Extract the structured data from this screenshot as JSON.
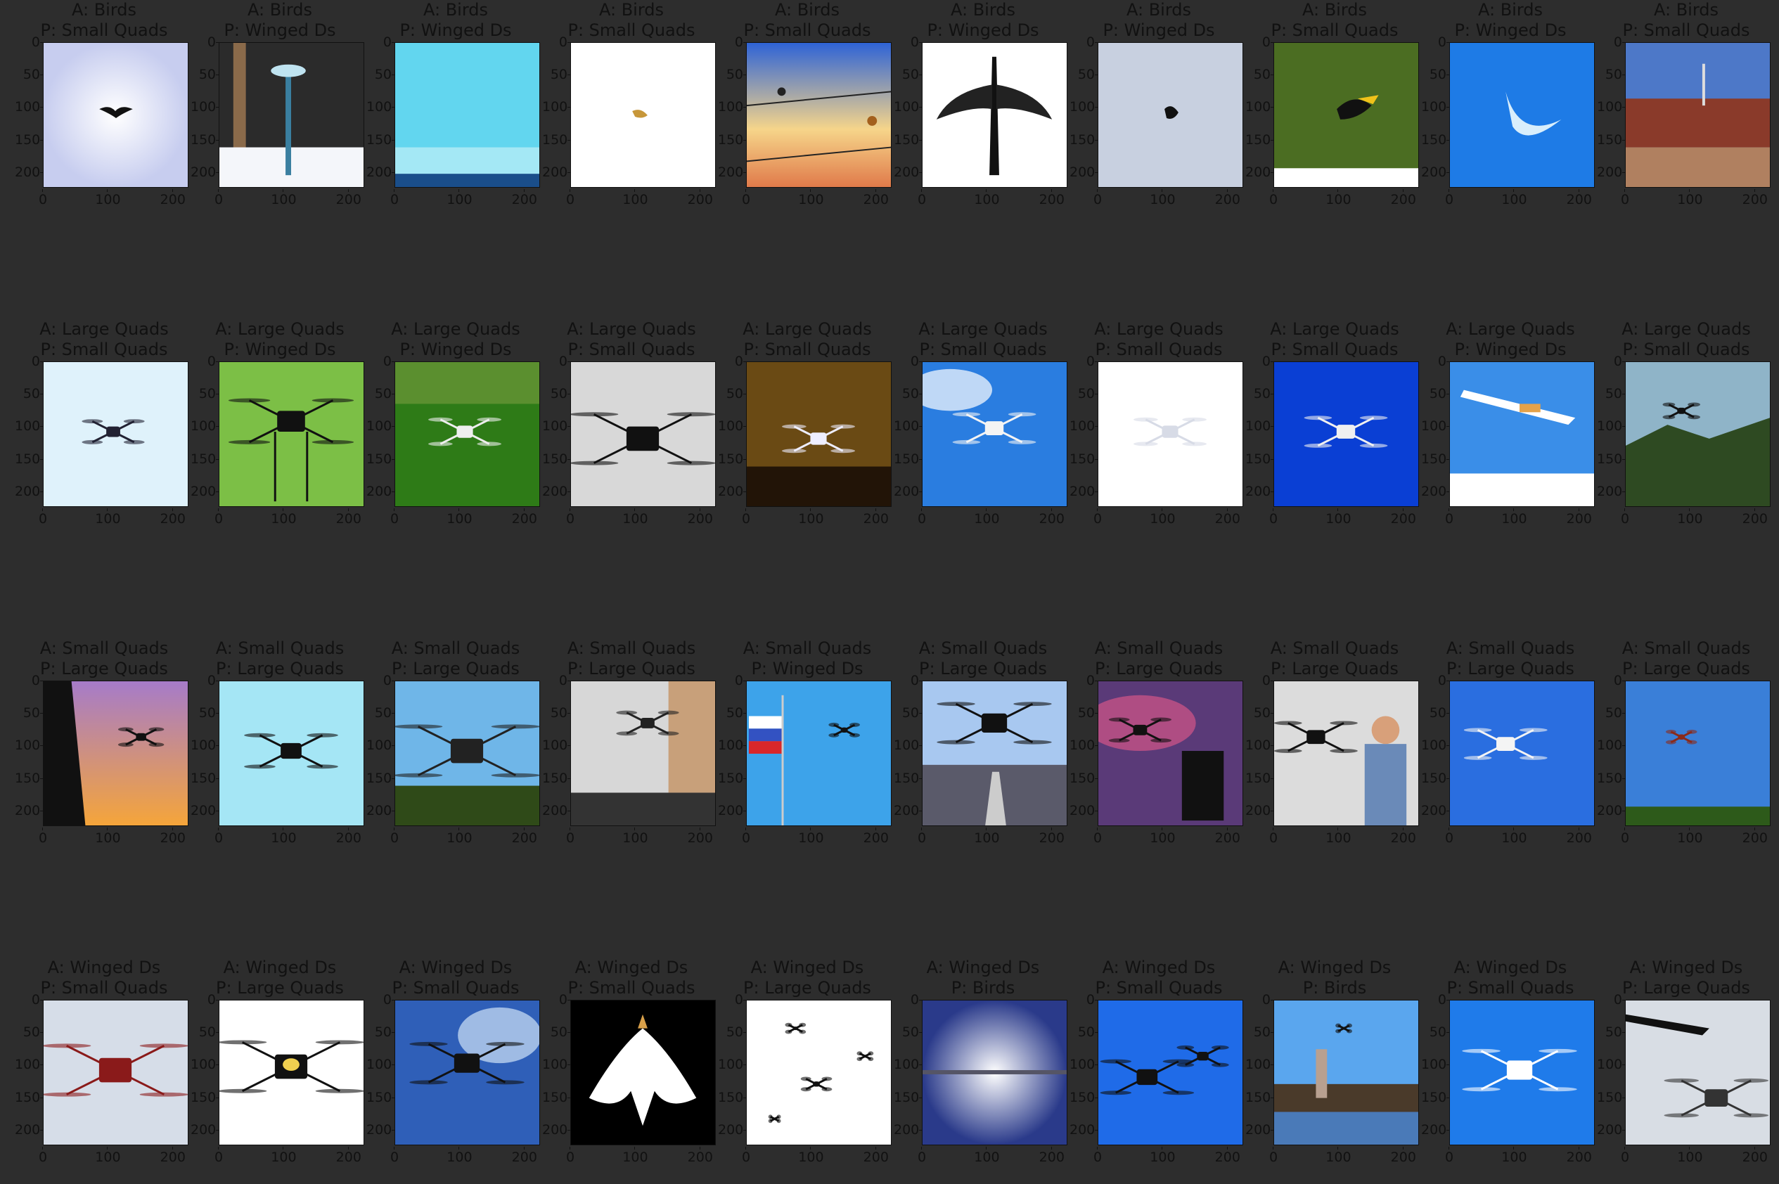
{
  "axes": {
    "y_ticks": [
      "0",
      "50",
      "100",
      "150",
      "200"
    ],
    "x_ticks": [
      "0",
      "100",
      "200"
    ]
  },
  "rows": [
    {
      "panels": [
        {
          "actual": "A: Birds",
          "predicted": "P:  Small Quads",
          "scene": "bird-silhouette-white",
          "bg": "#eef1fb"
        },
        {
          "actual": "A: Birds",
          "predicted": "P:  Winged Ds",
          "scene": "bird-feeder-snow",
          "bg": "#2b2b2b"
        },
        {
          "actual": "A: Birds",
          "predicted": "P:  Winged Ds",
          "scene": "sky-sea",
          "bg": "#6fd8ee"
        },
        {
          "actual": "A: Birds",
          "predicted": "P:  Small Quads",
          "scene": "bird-white",
          "bg": "#ffffff"
        },
        {
          "actual": "A: Birds",
          "predicted": "P:  Small Quads",
          "scene": "birds-on-wire-sunset",
          "bg": "#3a6bd8"
        },
        {
          "actual": "A: Birds",
          "predicted": "P:  Winged Ds",
          "scene": "bird-wings-spread",
          "bg": "#ffffff"
        },
        {
          "actual": "A: Birds",
          "predicted": "P:  Winged Ds",
          "scene": "bird-grey-sky",
          "bg": "#c8d0e0"
        },
        {
          "actual": "A: Birds",
          "predicted": "P:  Small Quads",
          "scene": "hornbill-forest",
          "bg": "#4b6d22"
        },
        {
          "actual": "A: Birds",
          "predicted": "P:  Winged Ds",
          "scene": "bird-blue-sky",
          "bg": "#1e7be6"
        },
        {
          "actual": "A: Birds",
          "predicted": "P:  Small Quads",
          "scene": "village-street",
          "bg": "#4d78c8"
        }
      ]
    },
    {
      "panels": [
        {
          "actual": "A: Large Quads",
          "predicted": "P:  Small Quads",
          "scene": "quad-pale-sky",
          "bg": "#dff2fb"
        },
        {
          "actual": "A: Large Quads",
          "predicted": "P:  Winged Ds",
          "scene": "hexacopter-grass",
          "bg": "#7cbf46"
        },
        {
          "actual": "A: Large Quads",
          "predicted": "P:  Winged Ds",
          "scene": "phantom-lawn",
          "bg": "#2e7b17"
        },
        {
          "actual": "A: Large Quads",
          "predicted": "P:  Small Quads",
          "scene": "quad-gravel",
          "bg": "#d8d8d8"
        },
        {
          "actual": "A: Large Quads",
          "predicted": "P:  Small Quads",
          "scene": "quad-wheat",
          "bg": "#6a4a14"
        },
        {
          "actual": "A: Large Quads",
          "predicted": "P:  Small Quads",
          "scene": "phantom-clouds",
          "bg": "#2a7de0"
        },
        {
          "actual": "A: Large Quads",
          "predicted": "P:  Small Quads",
          "scene": "quad-white-faint",
          "bg": "#ffffff"
        },
        {
          "actual": "A: Large Quads",
          "predicted": "P:  Small Quads",
          "scene": "phantom-deep-blue",
          "bg": "#0a3fd4"
        },
        {
          "actual": "A: Large Quads",
          "predicted": "P:  Winged Ds",
          "scene": "plane-clouds",
          "bg": "#3a8ee8"
        },
        {
          "actual": "A: Large Quads",
          "predicted": "P:  Small Quads",
          "scene": "quad-mountains",
          "bg": "#8fb4c8"
        }
      ]
    },
    {
      "panels": [
        {
          "actual": "A: Small Quads",
          "predicted": "P:  Large Quads",
          "scene": "quad-sunset",
          "bg": "#c56c8c"
        },
        {
          "actual": "A: Small Quads",
          "predicted": "P:  Large Quads",
          "scene": "quad-light-blue",
          "bg": "#a5e6f5"
        },
        {
          "actual": "A: Small Quads",
          "predicted": "P:  Large Quads",
          "scene": "octocopter-trees",
          "bg": "#6fb6e8"
        },
        {
          "actual": "A: Small Quads",
          "predicted": "P:  Large Quads",
          "scene": "quad-city-street",
          "bg": "#d7d7d7"
        },
        {
          "actual": "A: Small Quads",
          "predicted": "P:  Winged Ds",
          "scene": "flag-sky",
          "bg": "#3da3ea"
        },
        {
          "actual": "A: Small Quads",
          "predicted": "P:  Large Quads",
          "scene": "quad-runway",
          "bg": "#a8c8f0"
        },
        {
          "actual": "A: Small Quads",
          "predicted": "P:  Large Quads",
          "scene": "inspire-pink",
          "bg": "#5a3a78"
        },
        {
          "actual": "A: Small Quads",
          "predicted": "P:  Large Quads",
          "scene": "inspire-man",
          "bg": "#dcdcdc"
        },
        {
          "actual": "A: Small Quads",
          "predicted": "P:  Large Quads",
          "scene": "phantom-blue",
          "bg": "#2a6ee0"
        },
        {
          "actual": "A: Small Quads",
          "predicted": "P:  Large Quads",
          "scene": "quad-blue-coast",
          "bg": "#3a7fd8"
        }
      ]
    },
    {
      "panels": [
        {
          "actual": "A: Winged Ds",
          "predicted": "P:  Small Quads",
          "scene": "hexacopter-grey",
          "bg": "#d6dde8"
        },
        {
          "actual": "A: Winged Ds",
          "predicted": "P:  Large Quads",
          "scene": "quad-yellow-white",
          "bg": "#ffffff"
        },
        {
          "actual": "A: Winged Ds",
          "predicted": "P:  Small Quads",
          "scene": "quad-blue-clouds",
          "bg": "#2f5fb8"
        },
        {
          "actual": "A: Winged Ds",
          "predicted": "P:  Small Quads",
          "scene": "white-bird-black",
          "bg": "#000000"
        },
        {
          "actual": "A: Winged Ds",
          "predicted": "P:  Large Quads",
          "scene": "swarm-white",
          "bg": "#ffffff"
        },
        {
          "actual": "A: Winged Ds",
          "predicted": "P:  Birds",
          "scene": "fixed-wing-glow",
          "bg": "#e8ecf6"
        },
        {
          "actual": "A: Winged Ds",
          "predicted": "P:  Small Quads",
          "scene": "inspire-pair",
          "bg": "#1f6be8"
        },
        {
          "actual": "A: Winged Ds",
          "predicted": "P:  Birds",
          "scene": "pilot-lake",
          "bg": "#5aa6ee"
        },
        {
          "actual": "A: Winged Ds",
          "predicted": "P:  Small Quads",
          "scene": "phantom-bright-blue",
          "bg": "#1f7bea"
        },
        {
          "actual": "A: Winged Ds",
          "predicted": "P:  Large Quads",
          "scene": "plane-and-vtol",
          "bg": "#d8dde4"
        }
      ]
    }
  ]
}
